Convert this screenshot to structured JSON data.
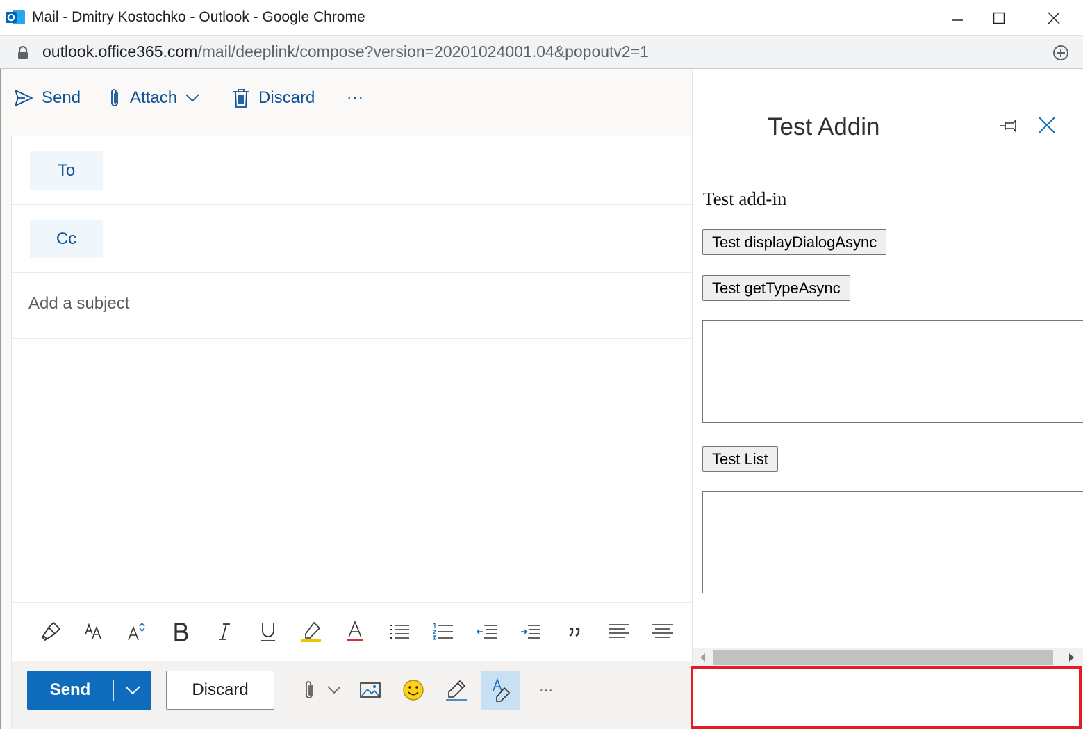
{
  "window": {
    "title": "Mail - Dmitry Kostochko - Outlook - Google Chrome",
    "url_host": "outlook.office365.com",
    "url_path": "/mail/deeplink/compose?version=20201024001.04&popoutv2=1"
  },
  "command_bar": {
    "send_label": "Send",
    "attach_label": "Attach",
    "discard_label": "Discard",
    "more_label": "···"
  },
  "compose": {
    "to_label": "To",
    "cc_label": "Cc",
    "subject_placeholder": "Add a subject"
  },
  "bottom_bar": {
    "send_label": "Send",
    "discard_label": "Discard",
    "more_label": "···"
  },
  "addin": {
    "title": "Test Addin",
    "heading": "Test add-in",
    "btn_dialog": "Test displayDialogAsync",
    "btn_gettype": "Test getTypeAsync",
    "btn_list": "Test List"
  },
  "colors": {
    "accent": "#0f6cbd",
    "link": "#0f5296",
    "highlight_border": "#e51c23"
  }
}
